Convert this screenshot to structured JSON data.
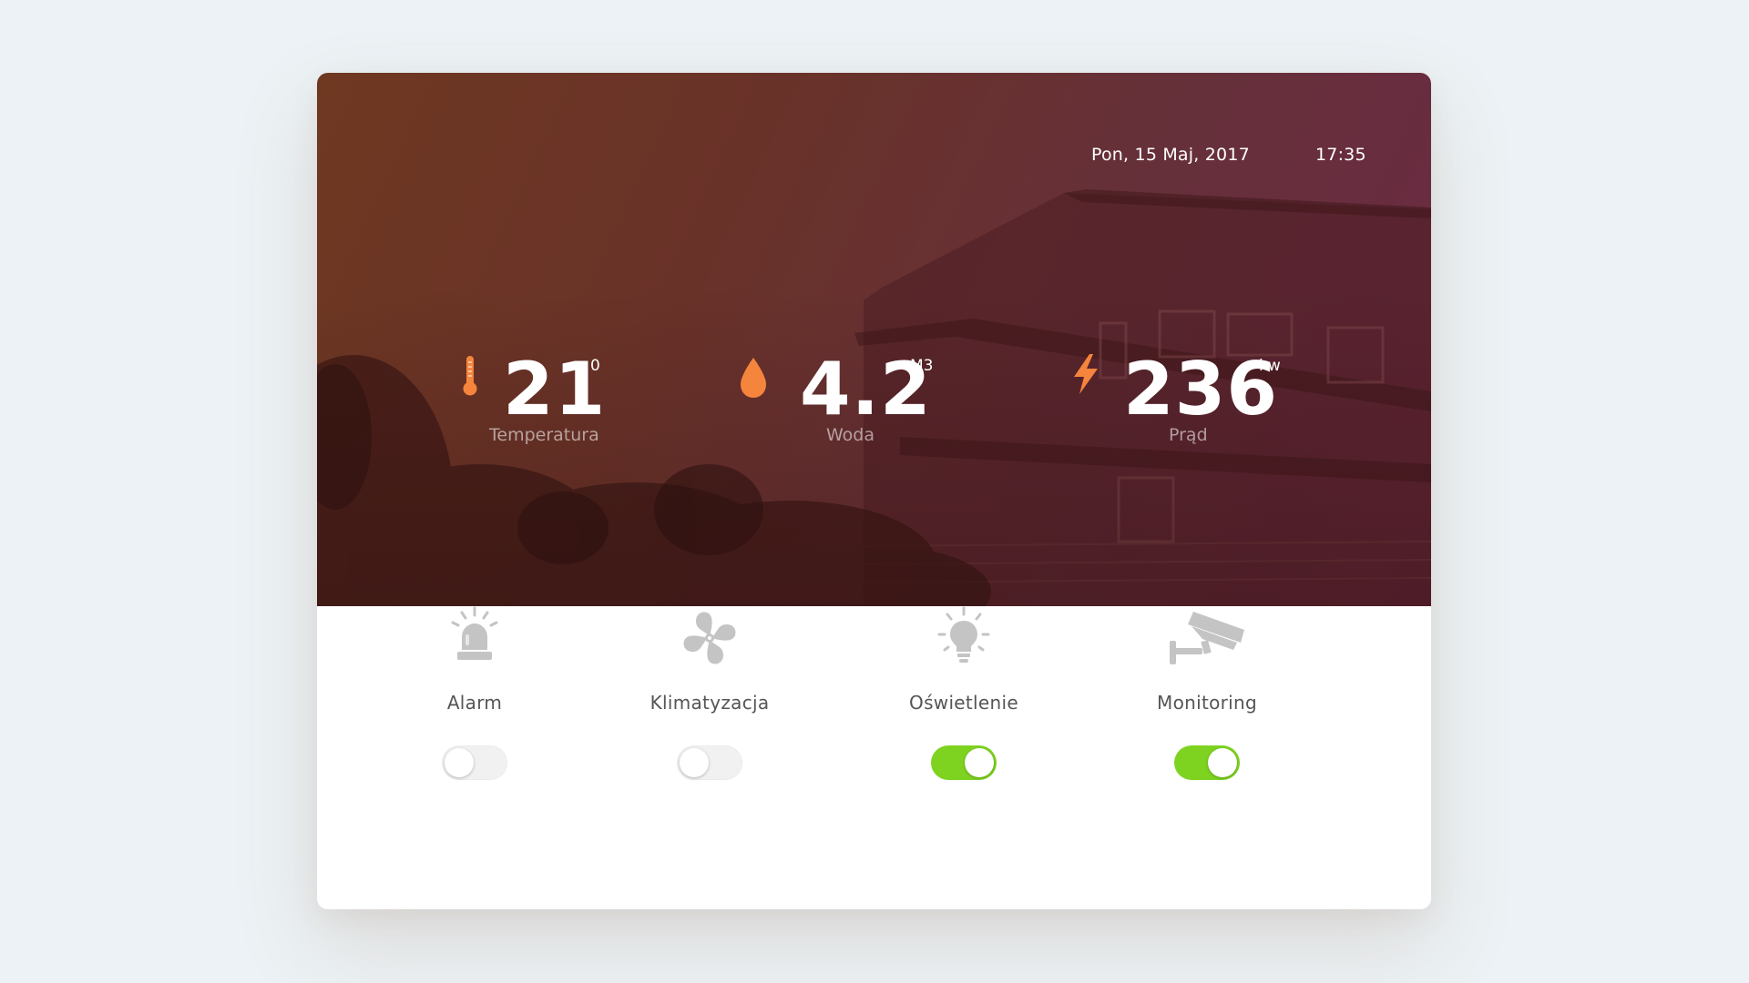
{
  "header": {
    "date": "Pon, 15 Maj, 2017",
    "time": "17:35"
  },
  "stats": {
    "temperature": {
      "value": "21",
      "unit": "0",
      "label": "Temperatura",
      "icon": "thermometer-icon"
    },
    "water": {
      "value": "4.2",
      "unit": "M3",
      "label": "Woda",
      "icon": "water-drop-icon"
    },
    "power": {
      "value": "236",
      "unit": "kw",
      "label": "Prąd",
      "icon": "lightning-icon"
    }
  },
  "devices": [
    {
      "label": "Alarm",
      "icon": "siren-icon",
      "enabled": false
    },
    {
      "label": "Klimatyzacja",
      "icon": "fan-icon",
      "enabled": false
    },
    {
      "label": "Oświetlenie",
      "icon": "lightbulb-icon",
      "enabled": true
    },
    {
      "label": "Monitoring",
      "icon": "security-camera-icon",
      "enabled": true
    }
  ],
  "colors": {
    "accent_orange": "#f5843c",
    "toggle_on": "#7ed321",
    "toggle_off": "#f1f1f1",
    "device_icon": "#c4c4c4",
    "hero_tint": "#6a3030"
  }
}
